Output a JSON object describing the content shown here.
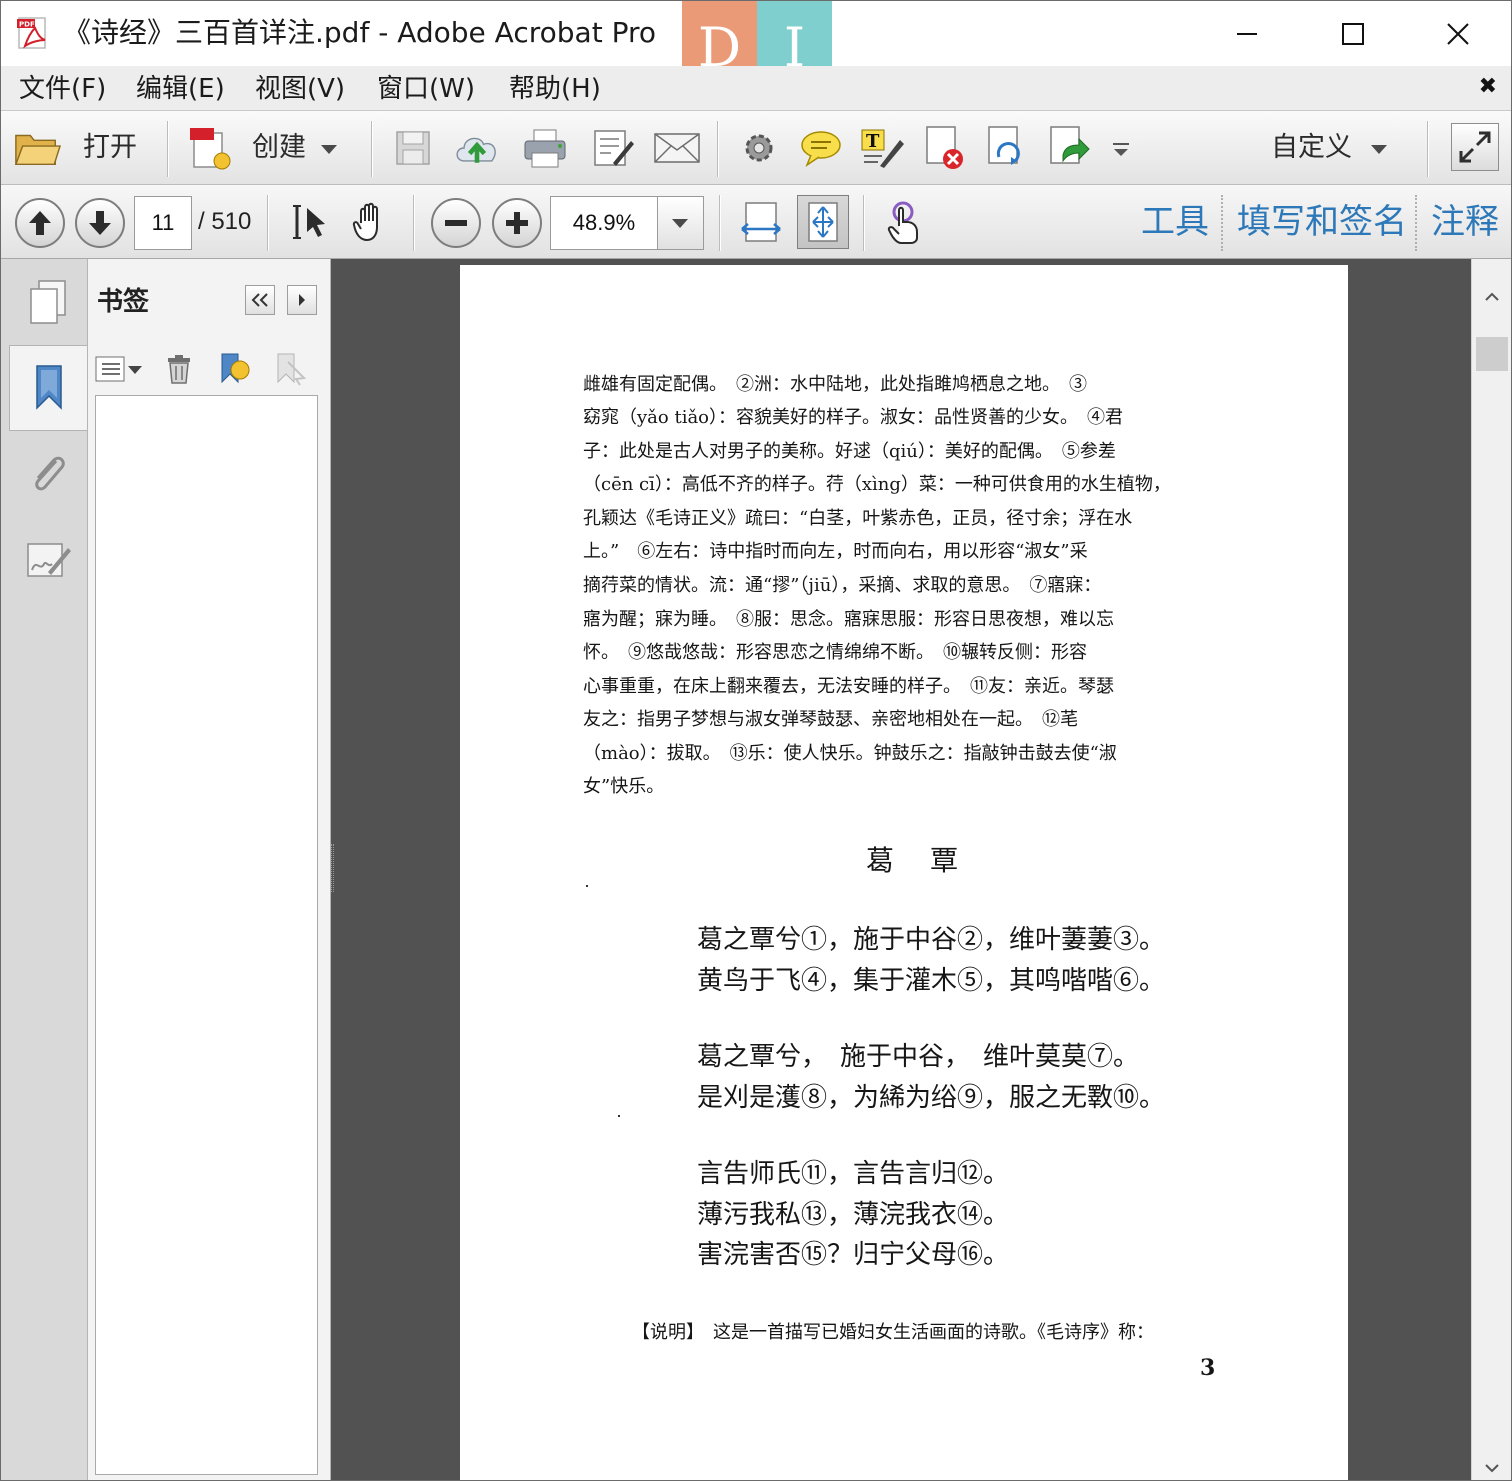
{
  "window": {
    "title": "《诗经》三百首详注.pdf - Adobe Acrobat Pro",
    "app_icon": "acrobat-pdf-icon",
    "pdf_badge": "PDF",
    "logo_left": "D",
    "logo_right": "I"
  },
  "menu": {
    "items": [
      "文件(F)",
      "编辑(E)",
      "视图(V)",
      "窗口(W)",
      "帮助(H)"
    ]
  },
  "toolbar": {
    "open_label": "打开",
    "create_label": "创建",
    "customize_label": "自定义"
  },
  "navigation": {
    "current_page": "11",
    "total_pages": "/ 510",
    "zoom": "48.9%"
  },
  "panes": {
    "tools": "工具",
    "fill_sign": "填写和签名",
    "comment": "注释"
  },
  "bookmarks": {
    "title": "书签"
  },
  "document": {
    "notes": [
      "雌雄有固定配偶。　②洲：水中陆地，此处指雎鸠栖息之地。　③",
      "窈窕（yǎo tiǎo）：容貌美好的样子。淑女：品性贤善的少女。　④君",
      "子：此处是古人对男子的美称。好逑（qiú）：美好的配偶。　⑤参差",
      "（cēn cī）：高低不齐的样子。荇（xìng）菜：一种可供食用的水生植物，",
      "孔颖达《毛诗正义》疏曰：“白茎，叶紫赤色，正员，径寸余；浮在水",
      "上。”　⑥左右：诗中指时而向左，时而向右，用以形容“淑女”采",
      "摘荇菜的情状。流：通“摎”（jiū），采摘、求取的意思。　⑦寤寐：",
      "寤为醒；寐为睡。　⑧服：思念。寤寐思服：形容日思夜想，难以忘",
      "怀。　⑨悠哉悠哉：形容思恋之情绵绵不断。　⑩辗转反侧：形容",
      "心事重重，在床上翻来覆去，无法安睡的样子。　⑪友：亲近。琴瑟",
      "友之：指男子梦想与淑女弹琴鼓瑟、亲密地相处在一起。　⑫芼",
      "（mào）：拔取。　⑬乐：使人快乐。钟鼓乐之：指敲钟击鼓去使“淑",
      "女”快乐。"
    ],
    "poem_title": "葛覃",
    "poem_lines": [
      "葛之覃兮①，施于中谷②，维叶萋萋③。",
      "黄鸟于飞④，集于灌木⑤，其鸣喈喈⑥。",
      "葛之覃兮，　施于中谷，　维叶莫莫⑦。",
      "是刈是濩⑧，为絺为绤⑨，服之无斁⑩。",
      "言告师氏⑪，言告言归⑫。",
      "薄污我私⑬，薄浣我衣⑭。",
      "害浣害否⑮？归宁父母⑯。"
    ],
    "caption": "【说明】　这是一首描写已婚妇女生活画面的诗歌。《毛诗序》称：",
    "page_number": "3"
  },
  "colors": {
    "link_blue": "#2d78b8",
    "doc_background": "#525252",
    "logo_orange": "#ea9a76",
    "logo_teal": "#7ecfcd"
  }
}
